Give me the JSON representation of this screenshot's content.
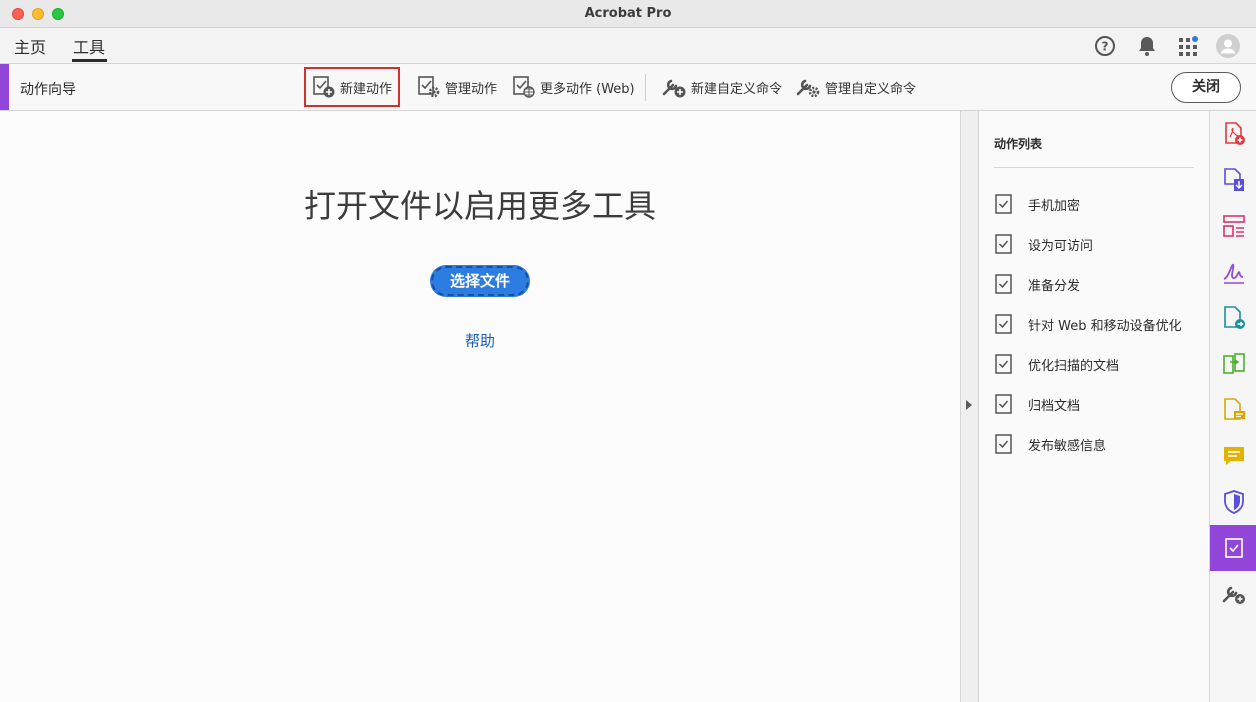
{
  "window": {
    "title": "Acrobat Pro"
  },
  "nav": {
    "tabs": [
      {
        "label": "主页"
      },
      {
        "label": "工具"
      }
    ],
    "icons": [
      "help-icon",
      "bell-icon",
      "apps-grid-icon",
      "avatar-icon"
    ]
  },
  "toolbar": {
    "title": "动作向导",
    "buttons": [
      {
        "label": "新建动作",
        "icon": "new-action-icon"
      },
      {
        "label": "管理动作",
        "icon": "manage-action-icon"
      },
      {
        "label": "更多动作 (Web)",
        "icon": "more-action-web-icon"
      },
      {
        "label": "新建自定义命令",
        "icon": "new-command-icon"
      },
      {
        "label": "管理自定义命令",
        "icon": "manage-command-icon"
      }
    ],
    "close_label": "关闭"
  },
  "main": {
    "heading": "打开文件以启用更多工具",
    "select_label": "选择文件",
    "help_label": "帮助"
  },
  "panel": {
    "title": "动作列表",
    "items": [
      {
        "label": "手机加密"
      },
      {
        "label": "设为可访问"
      },
      {
        "label": "准备分发"
      },
      {
        "label": "针对 Web 和移动设备优化"
      },
      {
        "label": "优化扫描的文档"
      },
      {
        "label": "归档文档"
      },
      {
        "label": "发布敏感信息"
      }
    ]
  },
  "rail": {
    "icons": [
      "create-pdf-icon",
      "export-pdf-icon",
      "organize-pages-icon",
      "fill-sign-icon",
      "send-pdf-icon",
      "compare-icon",
      "comment-file-icon",
      "comment-icon",
      "protect-icon",
      "action-wizard-icon",
      "add-tool-icon"
    ],
    "active": "action-wizard-icon"
  },
  "colors": {
    "accent": "#9146d9",
    "primary": "#2d7ce2",
    "link": "#1b5fb5",
    "highlight": "#d0312f"
  }
}
